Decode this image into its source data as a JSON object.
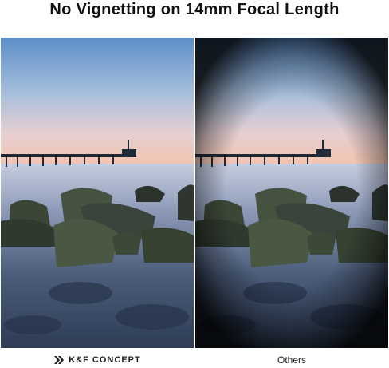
{
  "title": "No Vignetting on 14mm Focal Length",
  "left_panel": {
    "brand_name": "K&F CONCEPT",
    "logo_icon": "kf-logo-icon"
  },
  "right_panel": {
    "caption": "Others"
  },
  "colors": {
    "sky_top": "#5f8fc8",
    "sky_horizon": "#f2c7b6",
    "water": "#3a4f69",
    "rock": "#2f3a2e"
  }
}
